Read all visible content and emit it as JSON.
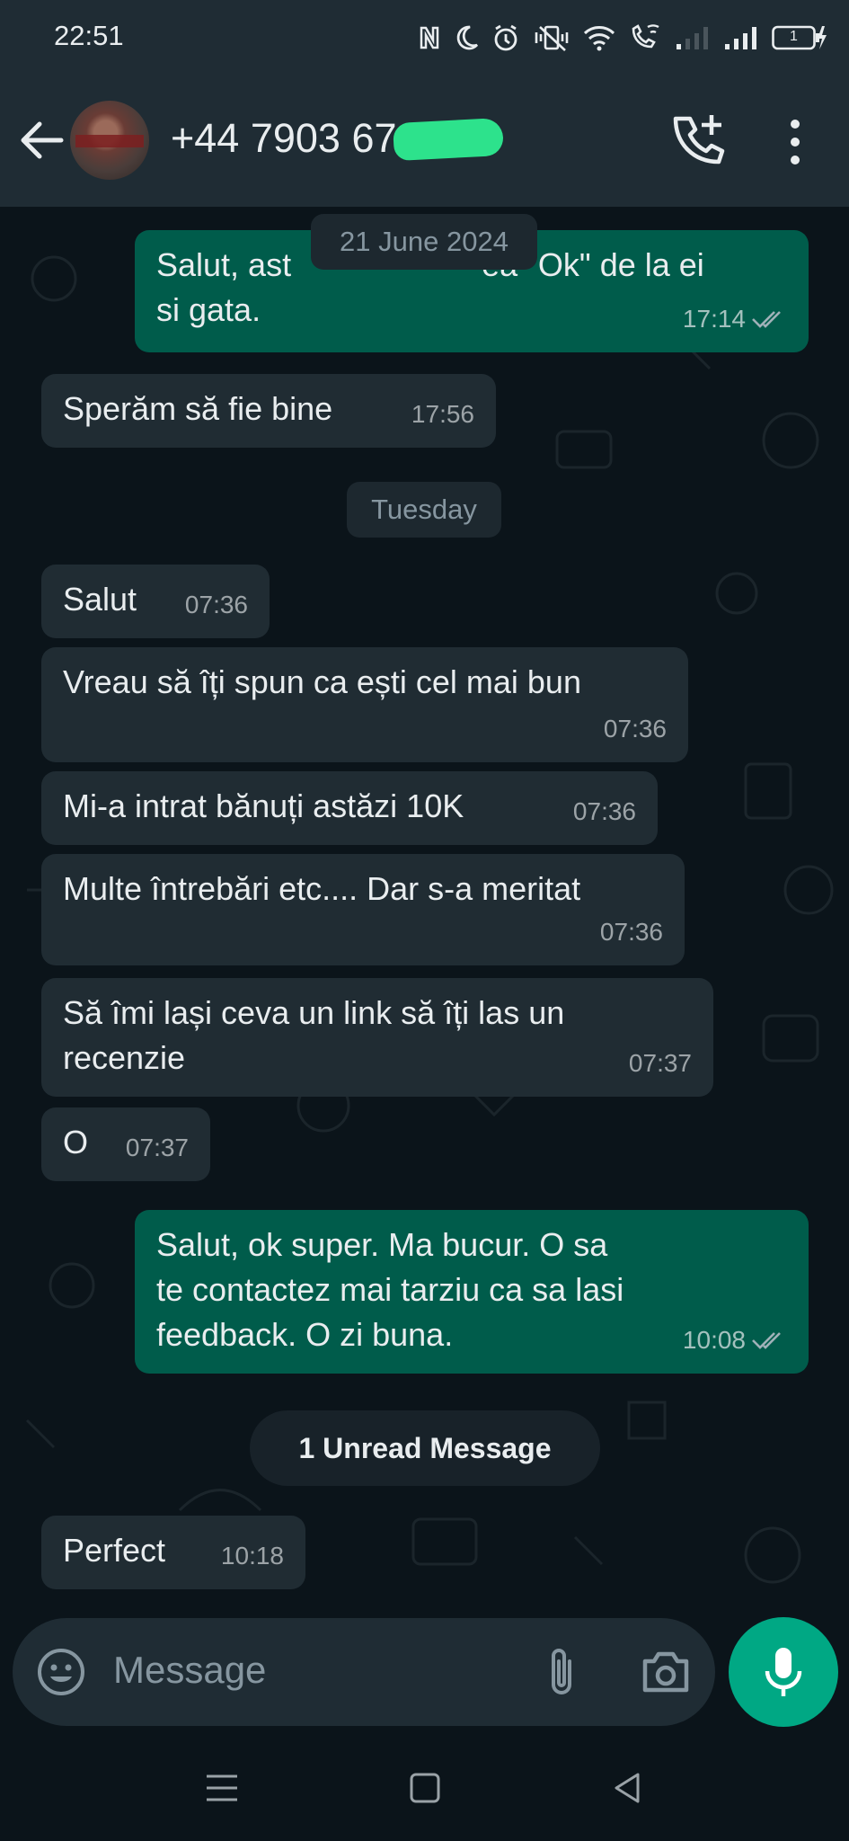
{
  "status_bar": {
    "time": "22:51",
    "battery_level": "1"
  },
  "header": {
    "contact_title": "+44 7903 67"
  },
  "composer": {
    "placeholder": "Message"
  },
  "date_chips": {
    "first": "21 June 2024",
    "second": "Tuesday"
  },
  "unread_banner": "1 Unread Message",
  "messages": [
    {
      "direction": "out",
      "text": "Salut, astepta confirmarea \"Ok\" de la ei si gata.",
      "line1": "Salut, ast",
      "line1_tail": "ea \"Ok\" de la ei",
      "line2": "si gata.",
      "time": "17:14",
      "status": "read"
    },
    {
      "direction": "in",
      "text": "Sperăm să fie bine",
      "time": "17:56"
    },
    {
      "direction": "in",
      "text": "Salut",
      "time": "07:36"
    },
    {
      "direction": "in",
      "text": "Vreau să îți spun ca ești cel mai bun",
      "time": "07:36"
    },
    {
      "direction": "in",
      "text": "Mi-a intrat bănuți astăzi 10K",
      "time": "07:36"
    },
    {
      "direction": "in",
      "text": "Multe întrebări etc.... Dar s-a meritat",
      "time": "07:36"
    },
    {
      "direction": "in",
      "text": "Să îmi lași ceva un link să îți las un\nrecenzie",
      "time": "07:37"
    },
    {
      "direction": "in",
      "text": "O",
      "time": "07:37"
    },
    {
      "direction": "out",
      "text": "Salut, ok super. Ma bucur. O sa\nte contactez mai tarziu ca sa lasi\nfeedback. O zi buna.",
      "time": "10:08",
      "status": "read"
    },
    {
      "direction": "in",
      "text": "Perfect",
      "time": "10:18"
    }
  ],
  "colors": {
    "background": "#0b141a",
    "bar": "#1f2c34",
    "incoming": "#202c33",
    "outgoing": "#005c4b",
    "accent": "#00a884"
  },
  "icons": [
    "back-arrow-icon",
    "add-call-icon",
    "more-options-icon",
    "emoji-icon",
    "attach-icon",
    "camera-icon",
    "mic-icon",
    "read-receipt-icon"
  ]
}
